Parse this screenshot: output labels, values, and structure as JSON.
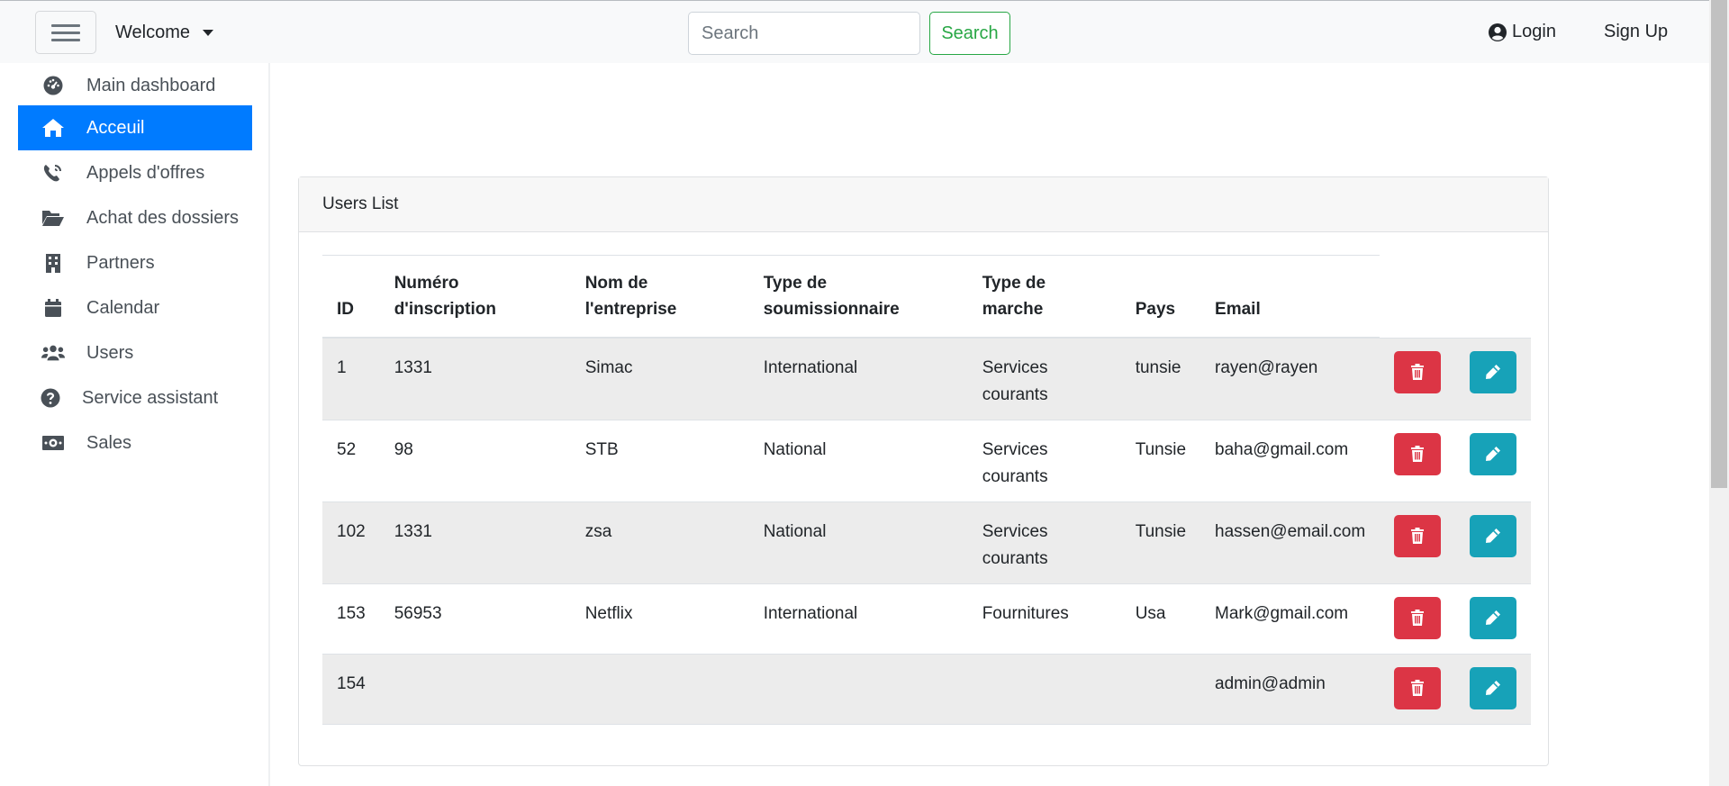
{
  "navbar": {
    "brand": "Welcome",
    "search_placeholder": "Search",
    "search_button": "Search",
    "login": "Login",
    "signup": "Sign Up"
  },
  "sidebar": {
    "items": [
      {
        "label": "Main dashboard",
        "icon": "tachometer-icon"
      },
      {
        "label": "Acceuil",
        "icon": "home-icon",
        "active": true
      },
      {
        "label": "Appels d'offres",
        "icon": "phone-volume-icon"
      },
      {
        "label": "Achat des dossiers",
        "icon": "folder-open-icon"
      },
      {
        "label": "Partners",
        "icon": "building-icon"
      },
      {
        "label": "Calendar",
        "icon": "calendar-icon"
      },
      {
        "label": "Users",
        "icon": "users-icon"
      },
      {
        "label": "Service assistant",
        "icon": "question-circle-icon"
      },
      {
        "label": "Sales",
        "icon": "money-bill-icon"
      }
    ]
  },
  "card": {
    "title": "Users List",
    "columns": [
      "ID",
      "Numéro d'inscription",
      "Nom de l'entreprise",
      "Type de soumissionnaire",
      "Type de marche",
      "Pays",
      "Email"
    ],
    "rows": [
      {
        "id": "1",
        "numero": "1331",
        "nom": "Simac",
        "type_soum": "International",
        "type_marche": "Services courants",
        "pays": "tunsie",
        "email": "rayen@rayen"
      },
      {
        "id": "52",
        "numero": "98",
        "nom": "STB",
        "type_soum": "National",
        "type_marche": "Services courants",
        "pays": "Tunsie",
        "email": "baha@gmail.com"
      },
      {
        "id": "102",
        "numero": "1331",
        "nom": "zsa",
        "type_soum": "National",
        "type_marche": "Services courants",
        "pays": "Tunsie",
        "email": "hassen@email.com"
      },
      {
        "id": "153",
        "numero": "56953",
        "nom": "Netflix",
        "type_soum": "International",
        "type_marche": "Fournitures",
        "pays": "Usa",
        "email": "Mark@gmail.com"
      },
      {
        "id": "154",
        "numero": "",
        "nom": "",
        "type_soum": "",
        "type_marche": "",
        "pays": "",
        "email": "admin@admin"
      }
    ]
  },
  "colors": {
    "primary": "#007bff",
    "success": "#28a745",
    "danger": "#dc3545",
    "info": "#17a2b8"
  }
}
